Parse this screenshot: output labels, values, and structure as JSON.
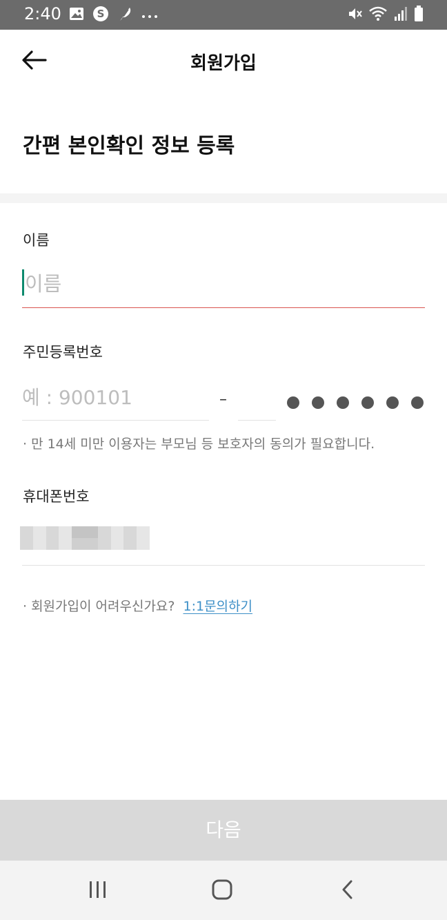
{
  "status_bar": {
    "time": "2:40",
    "left_icons": [
      "image-icon",
      "s-app-icon",
      "feather-icon",
      "more-dots-icon"
    ],
    "right_icons": [
      "mute-icon",
      "wifi-icon",
      "signal-icon",
      "battery-icon"
    ]
  },
  "header": {
    "title": "회원가입",
    "back_icon": "back-arrow-icon"
  },
  "section": {
    "title": "간편 본인확인 정보 등록"
  },
  "form": {
    "name": {
      "label": "이름",
      "placeholder": "이름",
      "value": ""
    },
    "rrn": {
      "label": "주민등록번호",
      "front_placeholder": "예 : 900101",
      "dash": "–",
      "masked_digit_count": 6,
      "notice": "· 만 14세 미만 이용자는 부모님 등 보호자의 동의가 필요합니다."
    },
    "phone": {
      "label": "휴대폰번호",
      "value_hidden": true
    },
    "help": {
      "text": "· 회원가입이 어려우신가요?",
      "link": "1:1문의하기"
    }
  },
  "next_button": {
    "label": "다음",
    "enabled": false
  },
  "nav_bar": {
    "buttons": [
      "recent-apps-icon",
      "home-icon",
      "back-icon"
    ]
  },
  "colors": {
    "status_bar_bg": "#6b6b6b",
    "accent_caret": "#0d8a6e",
    "active_underline": "#d9534f",
    "link": "#3d8fc7",
    "disabled_button_bg": "#d9d9d9"
  }
}
